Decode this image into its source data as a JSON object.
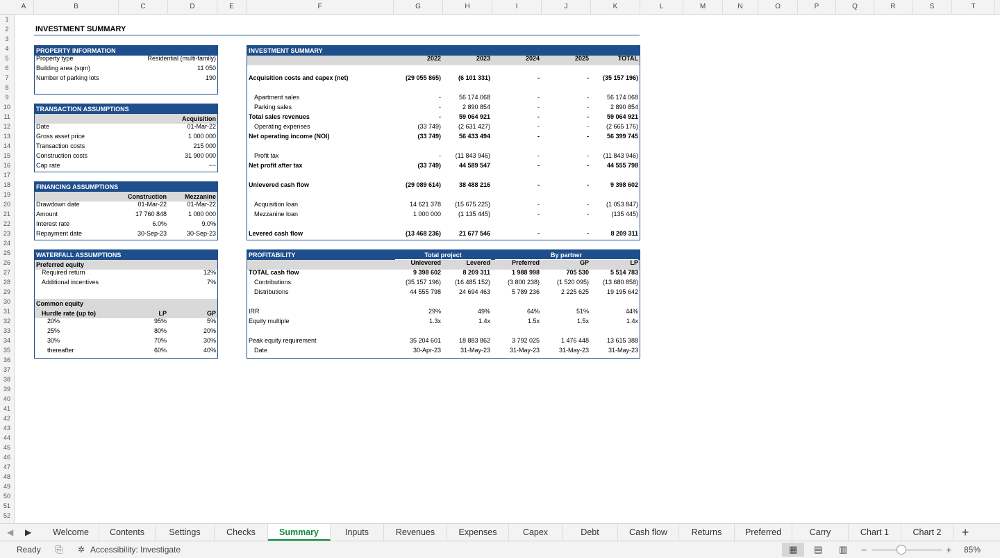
{
  "columns": [
    "A",
    "B",
    "C",
    "D",
    "E",
    "F",
    "G",
    "H",
    "I",
    "J",
    "K",
    "L",
    "M",
    "N",
    "O",
    "P",
    "Q",
    "R",
    "S",
    "T"
  ],
  "rows": [
    "1",
    "2",
    "3",
    "4",
    "5",
    "6",
    "7",
    "8",
    "9",
    "10",
    "11",
    "12",
    "13",
    "14",
    "15",
    "16",
    "17",
    "18",
    "19",
    "20",
    "21",
    "22",
    "23",
    "24",
    "25",
    "26",
    "27",
    "28",
    "29",
    "30",
    "31",
    "32",
    "33",
    "34",
    "35",
    "36",
    "37",
    "38",
    "39",
    "40",
    "41",
    "42",
    "43",
    "44",
    "45",
    "46",
    "47",
    "48",
    "49",
    "50",
    "51",
    "52"
  ],
  "sheet_title": "INVESTMENT SUMMARY",
  "property": {
    "header": "PROPERTY INFORMATION",
    "rows": [
      {
        "label": "Property type",
        "value": "Residential (multi-family)"
      },
      {
        "label": "Building area (sqm)",
        "value": "11 050"
      },
      {
        "label": "Number of parking lots",
        "value": "190"
      }
    ]
  },
  "transaction": {
    "header": "TRANSACTION ASSUMPTIONS",
    "col": "Acquisition",
    "rows": [
      {
        "label": "Date",
        "value": "01-Mar-22"
      },
      {
        "label": "Gross asset price",
        "value": "1 000 000"
      },
      {
        "label": "Transaction costs",
        "value": "215 000"
      },
      {
        "label": "Construction costs",
        "value": "31 900 000"
      },
      {
        "label": "Cap rate",
        "value": "~~"
      }
    ]
  },
  "financing": {
    "header": "FINANCING ASSUMPTIONS",
    "cols": [
      "Construction",
      "Mezzanine"
    ],
    "rows": [
      {
        "label": "Drawdown date",
        "v1": "01-Mar-22",
        "v2": "01-Mar-22"
      },
      {
        "label": "Amount",
        "v1": "17 760 848",
        "v2": "1 000 000"
      },
      {
        "label": "Interest rate",
        "v1": "6.0%",
        "v2": "9.0%"
      },
      {
        "label": "Repayment date",
        "v1": "30-Sep-23",
        "v2": "30-Sep-23"
      }
    ]
  },
  "waterfall": {
    "header": "WATERFALL ASSUMPTIONS",
    "preferred_label": "Preferred equity",
    "pref_rows": [
      {
        "label": "Required return",
        "value": "12%"
      },
      {
        "label": "Additional incentives",
        "value": "7%"
      }
    ],
    "common_label": "Common equity",
    "hurdle_label": "Hurdle rate (up to)",
    "lp": "LP",
    "gp": "GP",
    "hurdles": [
      {
        "rate": "20%",
        "lp": "95%",
        "gp": "5%"
      },
      {
        "rate": "25%",
        "lp": "80%",
        "gp": "20%"
      },
      {
        "rate": "30%",
        "lp": "70%",
        "gp": "30%"
      },
      {
        "rate": "thereafter",
        "lp": "60%",
        "gp": "40%"
      }
    ]
  },
  "summary": {
    "header": "INVESTMENT SUMMARY",
    "years": [
      "2022",
      "2023",
      "2024",
      "2025",
      "TOTAL"
    ],
    "rows": [
      {
        "label": "Acquisition costs and capex (net)",
        "bold": true,
        "indent": false,
        "vals": [
          "(29 055 865)",
          "(6 101 331)",
          "-",
          "-",
          "(35 157 196)"
        ],
        "row": 7
      },
      {
        "label": "Apartment sales",
        "bold": false,
        "indent": true,
        "vals": [
          "-",
          "56 174 068",
          "-",
          "-",
          "56 174 068"
        ],
        "row": 9
      },
      {
        "label": "Parking sales",
        "bold": false,
        "indent": true,
        "vals": [
          "-",
          "2 890 854",
          "-",
          "-",
          "2 890 854"
        ],
        "row": 10
      },
      {
        "label": "Total sales revenues",
        "bold": true,
        "indent": false,
        "vals": [
          "-",
          "59 064 921",
          "-",
          "-",
          "59 064 921"
        ],
        "row": 11
      },
      {
        "label": "Operating expenses",
        "bold": false,
        "indent": true,
        "vals": [
          "(33 749)",
          "(2 631 427)",
          "-",
          "-",
          "(2 665 176)"
        ],
        "row": 12
      },
      {
        "label": "Net operating income (NOI)",
        "bold": true,
        "indent": false,
        "vals": [
          "(33 749)",
          "56 433 494",
          "-",
          "-",
          "56 399 745"
        ],
        "row": 13
      },
      {
        "label": "Profit tax",
        "bold": false,
        "indent": true,
        "vals": [
          "-",
          "(11 843 946)",
          "-",
          "-",
          "(11 843 946)"
        ],
        "row": 15
      },
      {
        "label": "Net profit after tax",
        "bold": true,
        "indent": false,
        "vals": [
          "(33 749)",
          "44 589 547",
          "-",
          "-",
          "44 555 798"
        ],
        "row": 16
      },
      {
        "label": "Unlevered cash flow",
        "bold": true,
        "indent": false,
        "vals": [
          "(29 089 614)",
          "38 488 216",
          "-",
          "-",
          "9 398 602"
        ],
        "row": 18
      },
      {
        "label": "Acquisition loan",
        "bold": false,
        "indent": true,
        "vals": [
          "14 621 378",
          "(15 675 225)",
          "-",
          "-",
          "(1 053 847)"
        ],
        "row": 20
      },
      {
        "label": "Mezzanine loan",
        "bold": false,
        "indent": true,
        "vals": [
          "1 000 000",
          "(1 135 445)",
          "-",
          "-",
          "(135 445)"
        ],
        "row": 21
      },
      {
        "label": "Levered cash flow",
        "bold": true,
        "indent": false,
        "vals": [
          "(13 468 236)",
          "21 677 546",
          "-",
          "-",
          "8 209 311"
        ],
        "row": 23
      }
    ]
  },
  "profitability": {
    "header": "PROFITABILITY",
    "group1": "Total project",
    "group2": "By partner",
    "cols": [
      "Unlevered",
      "Levered",
      "Preferred",
      "GP",
      "LP"
    ],
    "rows": [
      {
        "label": "TOTAL cash flow",
        "bold": true,
        "indent": false,
        "vals": [
          "9 398 602",
          "8 209 311",
          "1 988 998",
          "705 530",
          "5 514 783"
        ],
        "row": 27
      },
      {
        "label": "Contributions",
        "bold": false,
        "indent": true,
        "vals": [
          "(35 157 196)",
          "(16 485 152)",
          "(3 800 238)",
          "(1 520 095)",
          "(13 680 858)"
        ],
        "row": 28
      },
      {
        "label": "Distributions",
        "bold": false,
        "indent": true,
        "vals": [
          "44 555 798",
          "24 694 463",
          "5 789 236",
          "2 225 625",
          "19 195 642"
        ],
        "row": 29
      },
      {
        "label": "IRR",
        "bold": false,
        "indent": false,
        "vals": [
          "29%",
          "49%",
          "64%",
          "51%",
          "44%"
        ],
        "row": 31
      },
      {
        "label": "Equity multiple",
        "bold": false,
        "indent": false,
        "vals": [
          "1.3x",
          "1.4x",
          "1.5x",
          "1.5x",
          "1.4x"
        ],
        "row": 32
      },
      {
        "label": "Peak equity requirement",
        "bold": false,
        "indent": false,
        "vals": [
          "35 204 601",
          "18 883 862",
          "3 792 025",
          "1 476 448",
          "13 615 388"
        ],
        "row": 34
      },
      {
        "label": "Date",
        "bold": false,
        "indent": true,
        "vals": [
          "30-Apr-23",
          "31-May-23",
          "31-May-23",
          "31-May-23",
          "31-May-23"
        ],
        "row": 35
      }
    ]
  },
  "tabs": [
    "Welcome",
    "Contents",
    "Settings",
    "Checks",
    "Summary",
    "Inputs",
    "Revenues",
    "Expenses",
    "Capex",
    "Debt",
    "Cash flow",
    "Returns",
    "Preferred",
    "Carry",
    "Chart 1",
    "Chart 2"
  ],
  "active_tab": "Summary",
  "status": {
    "ready": "Ready",
    "accessibility": "Accessibility: Investigate",
    "zoom": "85%"
  },
  "colors": {
    "header_blue": "#1f4e8c",
    "gray": "#d9d9d9",
    "active_tab_green": "#0b8a3a"
  }
}
